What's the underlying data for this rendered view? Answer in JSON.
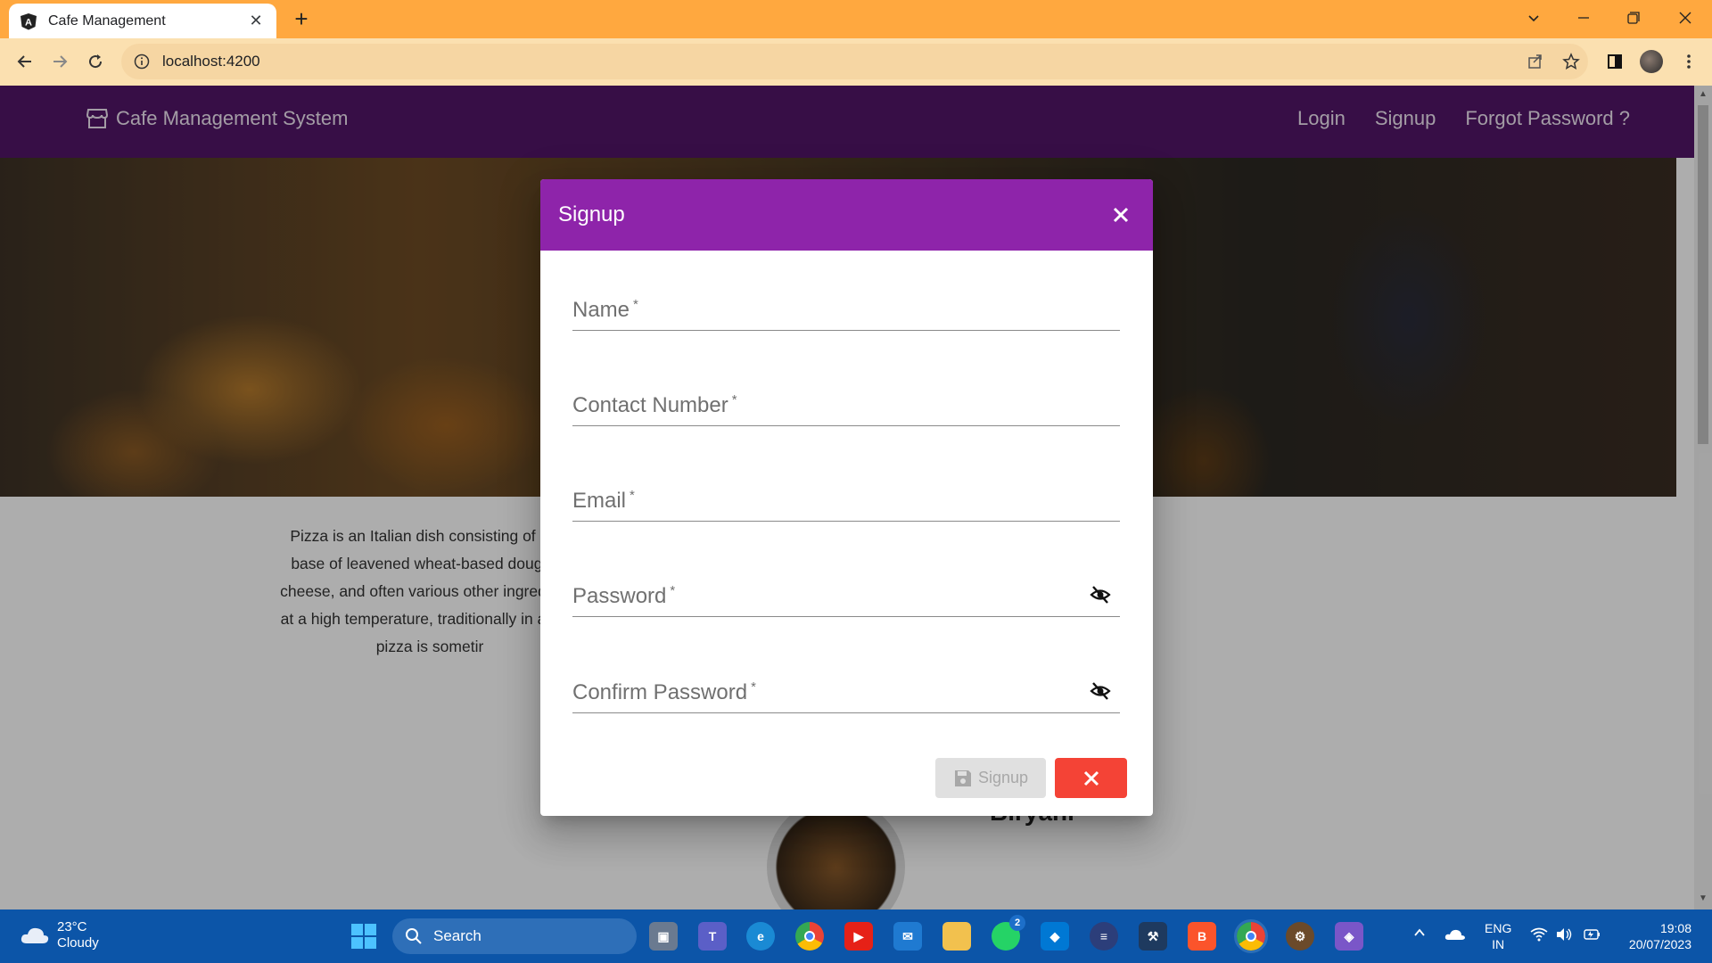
{
  "browser": {
    "tab_title": "Cafe Management",
    "url": "localhost:4200"
  },
  "app": {
    "brand": "Cafe Management System",
    "nav": {
      "login": "Login",
      "signup": "Signup",
      "forgot": "Forgot Password ?"
    },
    "pizza_text": "Pizza is an Italian dish consisting of a us… base of leavened wheat-based dough to… cheese, and often various other ingredients… at a high temperature, traditionally in a woo… pizza is someti…",
    "pizza_lines": [
      "Pizza is an Italian dish consisting of a us",
      "base of leavened wheat-based dough to",
      "cheese, and often various other ingredients",
      "at a high temperature, traditionally in a woo",
      "pizza is sometir"
    ],
    "food_title": "Biryani"
  },
  "dialog": {
    "title": "Signup",
    "fields": {
      "name": {
        "label": "Name",
        "required": "*",
        "value": ""
      },
      "contact": {
        "label": "Contact Number",
        "required": "*",
        "value": ""
      },
      "email": {
        "label": "Email",
        "required": "*",
        "value": ""
      },
      "password": {
        "label": "Password",
        "required": "*",
        "value": ""
      },
      "confirm": {
        "label": "Confirm Password",
        "required": "*",
        "value": ""
      }
    },
    "signup_button": "Signup",
    "colors": {
      "header": "#8e24aa",
      "cancel": "#f44336",
      "navbar": "#521667"
    }
  },
  "taskbar": {
    "weather_temp": "23°C",
    "weather_desc": "Cloudy",
    "search": "Search",
    "whatsapp_badge": "2",
    "lang_top": "ENG",
    "lang_bottom": "IN",
    "time": "19:08",
    "date": "20/07/2023"
  }
}
